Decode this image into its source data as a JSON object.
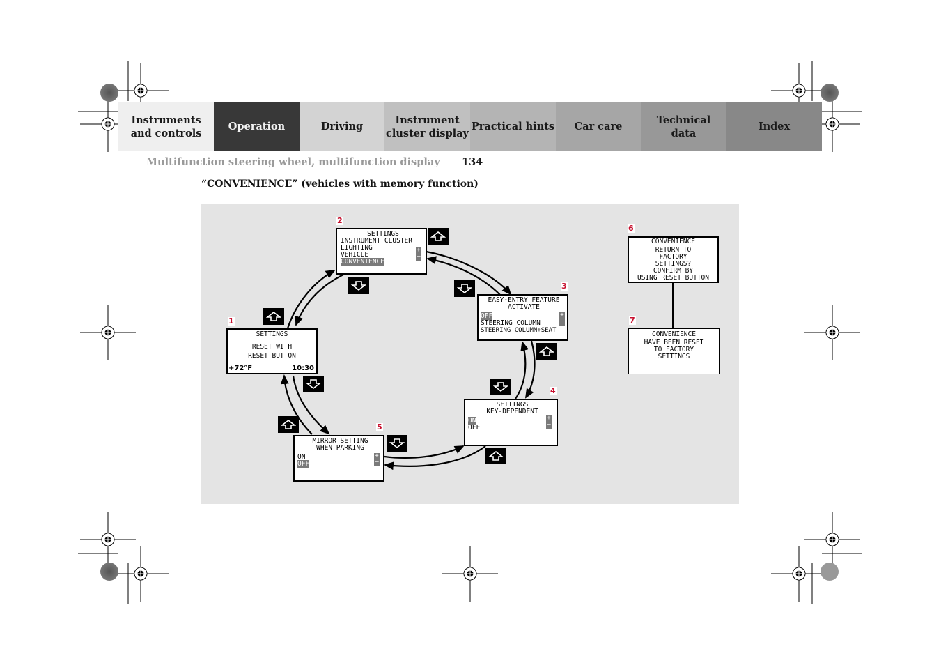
{
  "nav": {
    "tabs": [
      {
        "label": "Instruments\nand controls",
        "active": false,
        "color": "#efefef"
      },
      {
        "label": "Operation",
        "active": true,
        "color": "#383838"
      },
      {
        "label": "Driving",
        "active": false,
        "color": "#d3d3d3"
      },
      {
        "label": "Instrument\ncluster display",
        "active": false,
        "color": "#c0c0c0"
      },
      {
        "label": "Practical hints",
        "active": false,
        "color": "#b4b4b4"
      },
      {
        "label": "Car care",
        "active": false,
        "color": "#a6a6a6"
      },
      {
        "label": "Technical\ndata",
        "active": false,
        "color": "#989898"
      },
      {
        "label": "Index",
        "active": false,
        "color": "#888888"
      }
    ]
  },
  "header": {
    "title": "Multifunction steering wheel, multifunction display",
    "page_number": "134"
  },
  "section": {
    "title": "“CONVENIENCE” (vehicles with memory function)"
  },
  "colors": {
    "panel_bg": "#e4e4e4",
    "number_badge": "#c8102e",
    "highlight": "#7a7a7a"
  },
  "diagram": {
    "screens": {
      "s1": {
        "number": "1",
        "title": "SETTINGS",
        "lines": [
          "RESET WITH",
          "RESET BUTTON"
        ],
        "temp": "+72°F",
        "time": "10:30"
      },
      "s2": {
        "number": "2",
        "title": "SETTINGS",
        "lines": [
          "INSTRUMENT CLUSTER",
          "LIGHTING",
          "VEHICLE"
        ],
        "selected": "CONVENIENCE",
        "plus": "+",
        "minus": "–"
      },
      "s3": {
        "number": "3",
        "title": "EASY-ENTRY FEATURE",
        "subtitle": "ACTIVATE",
        "selected": "OFF",
        "lines": [
          "STEERING COLUMN",
          "STEERING COLUMN+SEAT"
        ],
        "plus": "+",
        "minus": "–"
      },
      "s4": {
        "number": "4",
        "title": "SETTINGS",
        "subtitle": "KEY-DEPENDENT",
        "selected": "ON",
        "lines": [
          "OFF"
        ],
        "plus": "+",
        "minus": "–"
      },
      "s5": {
        "number": "5",
        "title": "MIRROR SETTING",
        "subtitle": "WHEN PARKING",
        "lines": [
          "ON"
        ],
        "selected": "OFF",
        "plus": "+",
        "minus": "–"
      },
      "s6": {
        "number": "6",
        "title": "CONVENIENCE",
        "lines": [
          "RETURN TO",
          "FACTORY",
          "SETTINGS?",
          "CONFIRM BY",
          "USING RESET BUTTON"
        ]
      },
      "s7": {
        "number": "7",
        "title": "CONVENIENCE",
        "lines": [
          "HAVE BEEN RESET",
          "TO FACTORY",
          "SETTINGS"
        ]
      }
    },
    "buttons": [
      {
        "name": "up-arrow-button",
        "icon": "arrow-up"
      },
      {
        "name": "down-arrow-button",
        "icon": "arrow-down"
      }
    ]
  }
}
